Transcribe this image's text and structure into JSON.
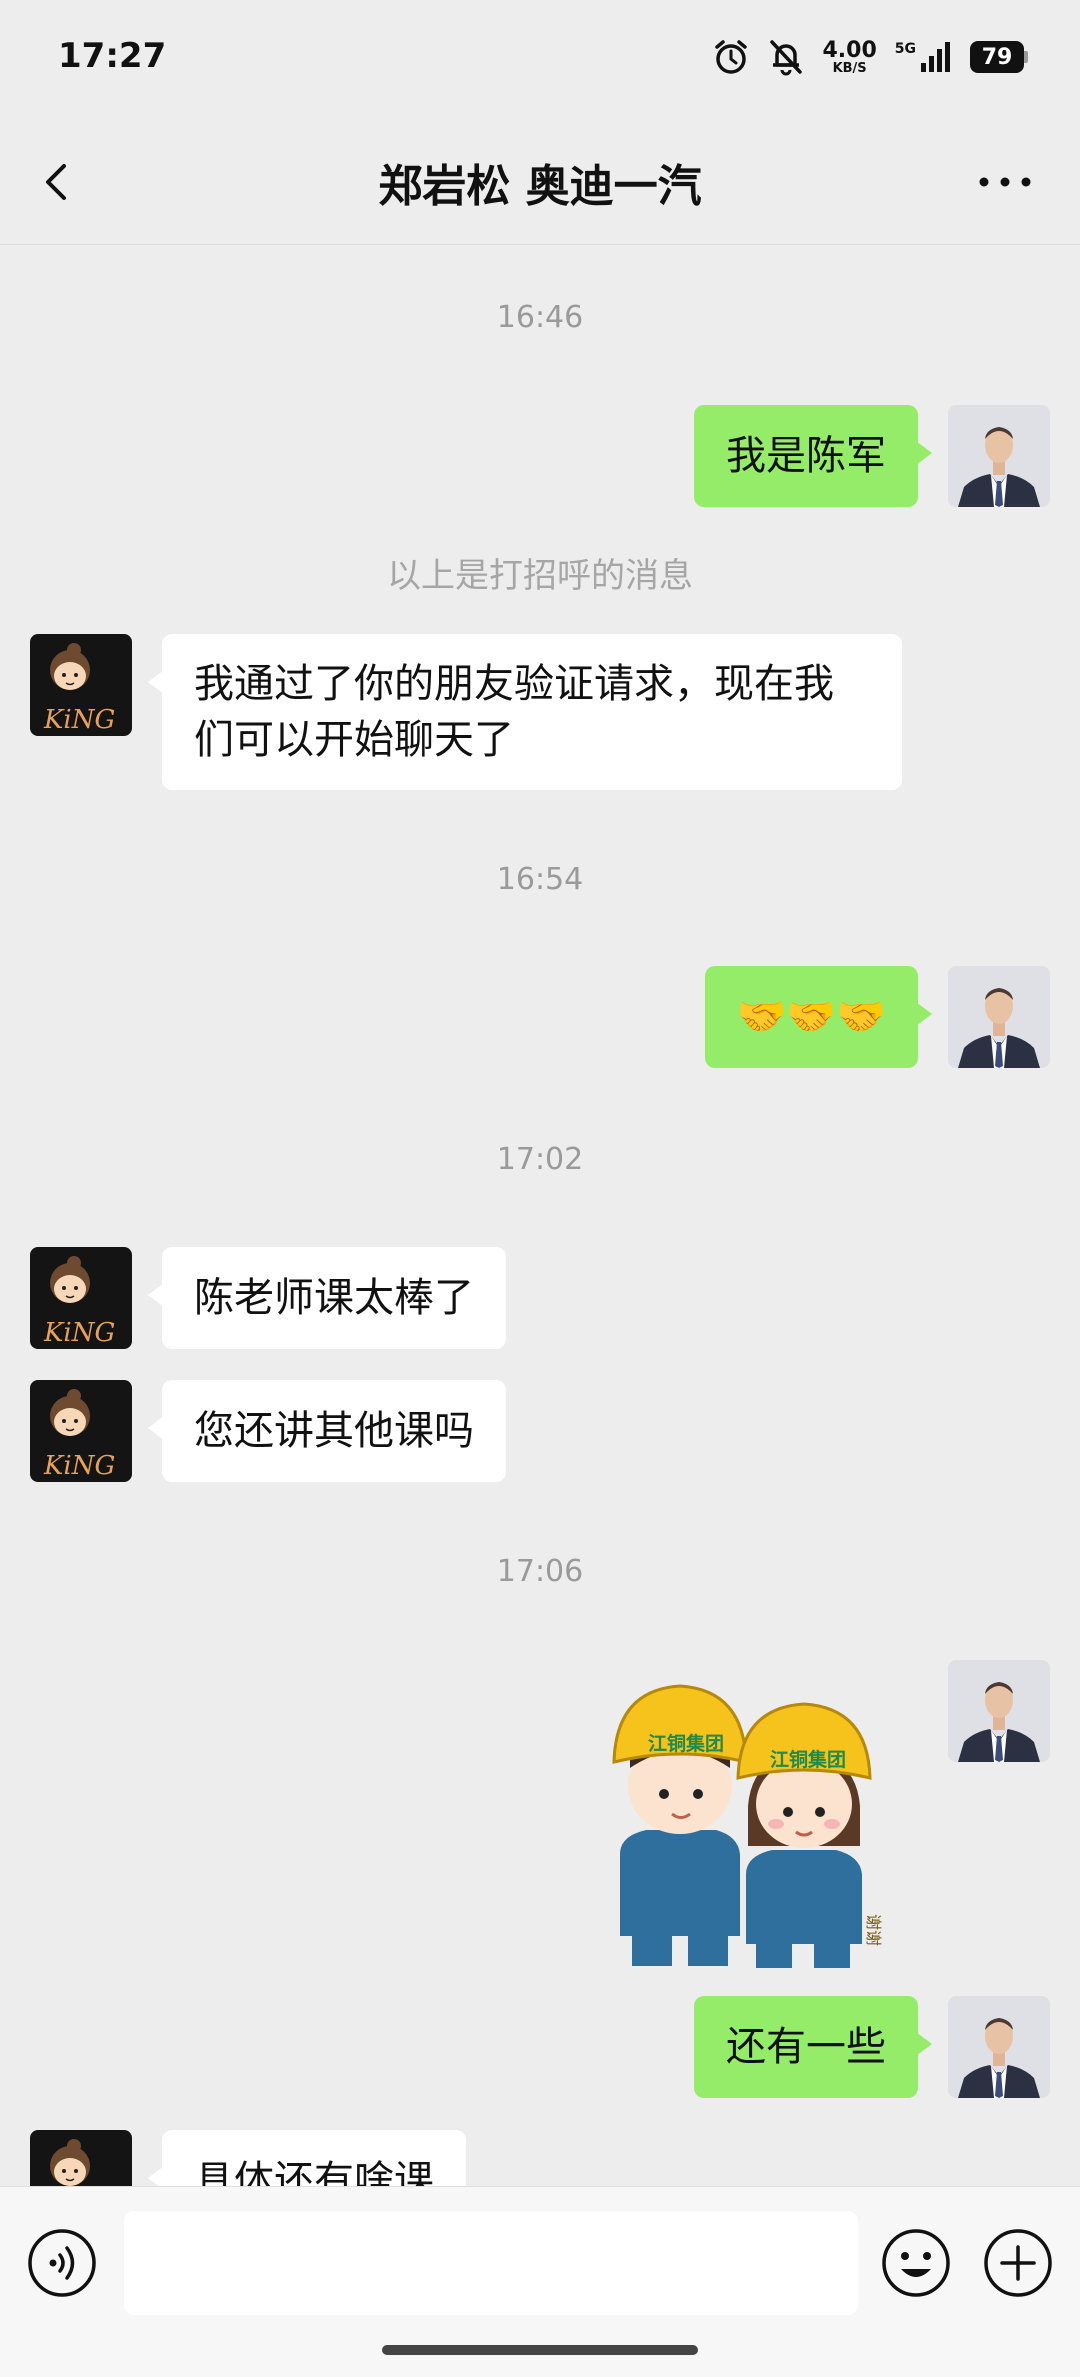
{
  "status_bar": {
    "time": "17:27",
    "net_speed_value": "4.00",
    "net_speed_unit": "KB/S",
    "network": "5G",
    "battery": "79",
    "icons": [
      "alarm-icon",
      "mute-bell-icon",
      "signal-icon",
      "battery-icon"
    ]
  },
  "header": {
    "title": "郑岩松  奥迪一汽",
    "back_icon": "back-chevron-icon",
    "more_icon": "more-dots-icon"
  },
  "messages": [
    {
      "type": "time",
      "text": "16:46"
    },
    {
      "type": "text",
      "sender": "me",
      "text": "我是陈军"
    },
    {
      "type": "system",
      "text": "以上是打招呼的消息"
    },
    {
      "type": "text",
      "sender": "them",
      "text": "我通过了你的朋友验证请求，现在我们可以开始聊天了"
    },
    {
      "type": "time",
      "text": "16:54"
    },
    {
      "type": "text",
      "sender": "me",
      "text": "🤝🤝🤝"
    },
    {
      "type": "time",
      "text": "17:02"
    },
    {
      "type": "text",
      "sender": "them",
      "text": "陈老师课太棒了"
    },
    {
      "type": "text",
      "sender": "them",
      "text": "您还讲其他课吗"
    },
    {
      "type": "time",
      "text": "17:06"
    },
    {
      "type": "sticker",
      "sender": "me",
      "sticker_text": "江铜集团",
      "sticker_side_text": "谢谢"
    },
    {
      "type": "text",
      "sender": "me",
      "text": "还有一些"
    },
    {
      "type": "text",
      "sender": "them",
      "text": "具体还有啥课"
    }
  ],
  "avatars": {
    "them_label": "KiNG"
  },
  "input_bar": {
    "voice_icon": "voice-icon",
    "emoji_icon": "emoji-icon",
    "plus_icon": "plus-icon",
    "input_value": ""
  },
  "colors": {
    "background": "#ededed",
    "my_bubble": "#95ec69",
    "their_bubble": "#ffffff"
  }
}
